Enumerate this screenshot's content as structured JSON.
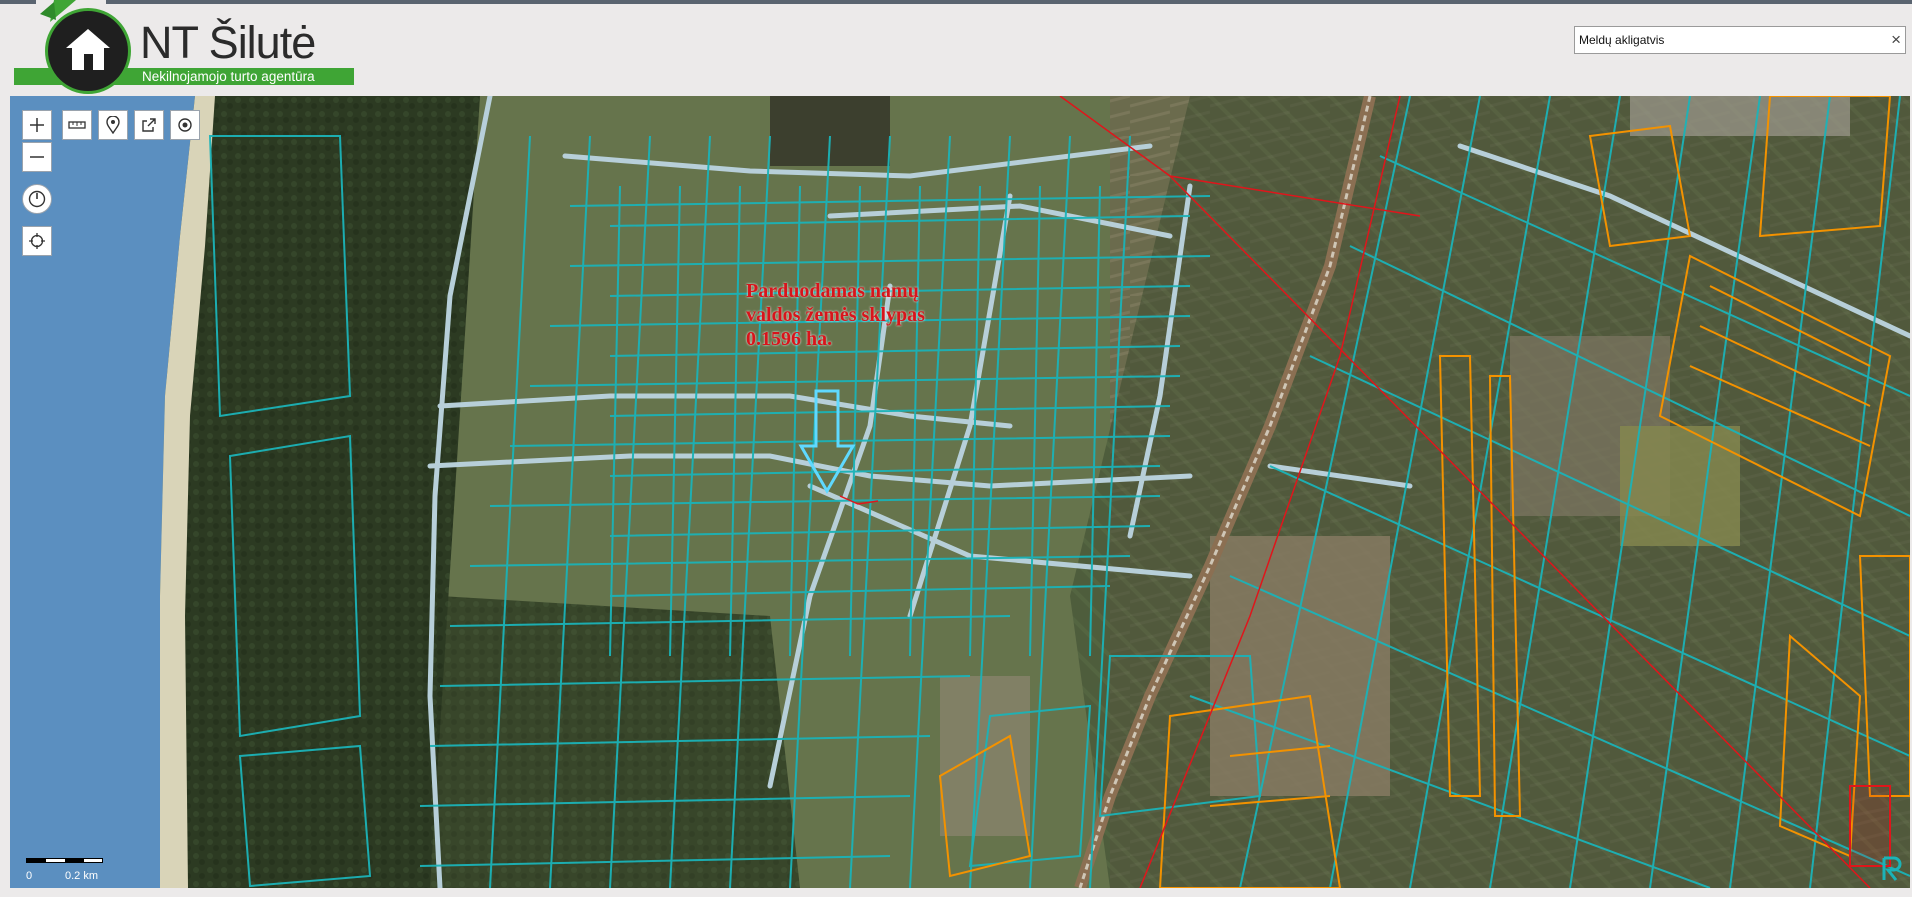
{
  "header": {
    "logo_title": "NT Šilutė",
    "logo_subtitle": "Nekilnojamojo turto agentūra"
  },
  "search": {
    "value": "Meldų akligatvis",
    "clear_symbol": "×"
  },
  "map": {
    "annotation_lines": [
      "Parduodamas namų",
      "valdos žemės sklypas",
      "0.1596 ha."
    ],
    "scale": {
      "zero": "0",
      "distance": "0.2 km"
    },
    "tools": [
      {
        "name": "zoom-in-button",
        "icon": "plus-icon"
      },
      {
        "name": "zoom-out-button",
        "icon": "minus-icon"
      },
      {
        "name": "measure-button",
        "icon": "ruler-icon"
      },
      {
        "name": "marker-button",
        "icon": "map-pin-icon"
      },
      {
        "name": "share-button",
        "icon": "share-icon"
      },
      {
        "name": "location-button",
        "icon": "target-icon"
      },
      {
        "name": "compass-button",
        "icon": "compass-icon"
      },
      {
        "name": "locate-me-button",
        "icon": "crosshair-icon"
      }
    ],
    "colors": {
      "parcel_lines": "#1bb3b8",
      "roads": "#b7cfd9",
      "orange_parcels": "#f39200",
      "power_lines": "#e0151b",
      "sea": "#5b8fc0",
      "annotation": "#d8141b",
      "arrow": "#5fd9ff"
    }
  }
}
